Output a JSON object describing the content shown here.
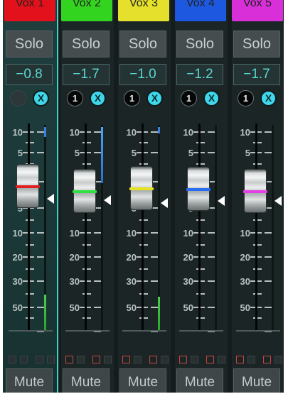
{
  "colors": {
    "accent": "#3ed3c8",
    "value_text": "#5ad6d0",
    "background": "#151c1d"
  },
  "channels": [
    {
      "name": "Vox 1",
      "tab_color": "#e2111b",
      "solo_label": "Solo",
      "value": "−0.8",
      "circle_a": "",
      "circle_b": "X",
      "line_color": "#e02020",
      "fader_level_db": -0.8,
      "meter_level": "-58..-40",
      "mute_label": "Mute",
      "selected": true
    },
    {
      "name": "Vox 2",
      "tab_color": "#33d41f",
      "solo_label": "Solo",
      "value": "−1.7",
      "circle_a": "1",
      "circle_b": "X",
      "line_color": "#2fe043",
      "fader_level_db": -1.7,
      "meter_level": "9..-1",
      "mute_label": "Mute",
      "selected": false
    },
    {
      "name": "Vox 3",
      "tab_color": "#e4e02b",
      "solo_label": "Solo",
      "value": "−1.0",
      "circle_a": "1",
      "circle_b": "X",
      "line_color": "#e7e21e",
      "fader_level_db": -1.0,
      "meter_level": "-59..-47",
      "mute_label": "Mute",
      "selected": false
    },
    {
      "name": "Vox 4",
      "tab_color": "#1d58e0",
      "solo_label": "Solo",
      "value": "−1.2",
      "circle_a": "1",
      "circle_b": "X",
      "line_color": "#2a6df0",
      "fader_level_db": -1.2,
      "meter_level": "none",
      "mute_label": "Mute",
      "selected": false
    },
    {
      "name": "Vox 5",
      "tab_color": "#d82fd8",
      "solo_label": "Solo",
      "value": "−1.7",
      "circle_a": "1",
      "circle_b": "X",
      "line_color": "#e43fe4",
      "fader_level_db": -1.7,
      "meter_level": "none",
      "mute_label": "Mute",
      "selected": false
    }
  ],
  "scale_labels": [
    "10",
    "5",
    "0",
    "5",
    "10",
    "20",
    "30",
    "50"
  ]
}
